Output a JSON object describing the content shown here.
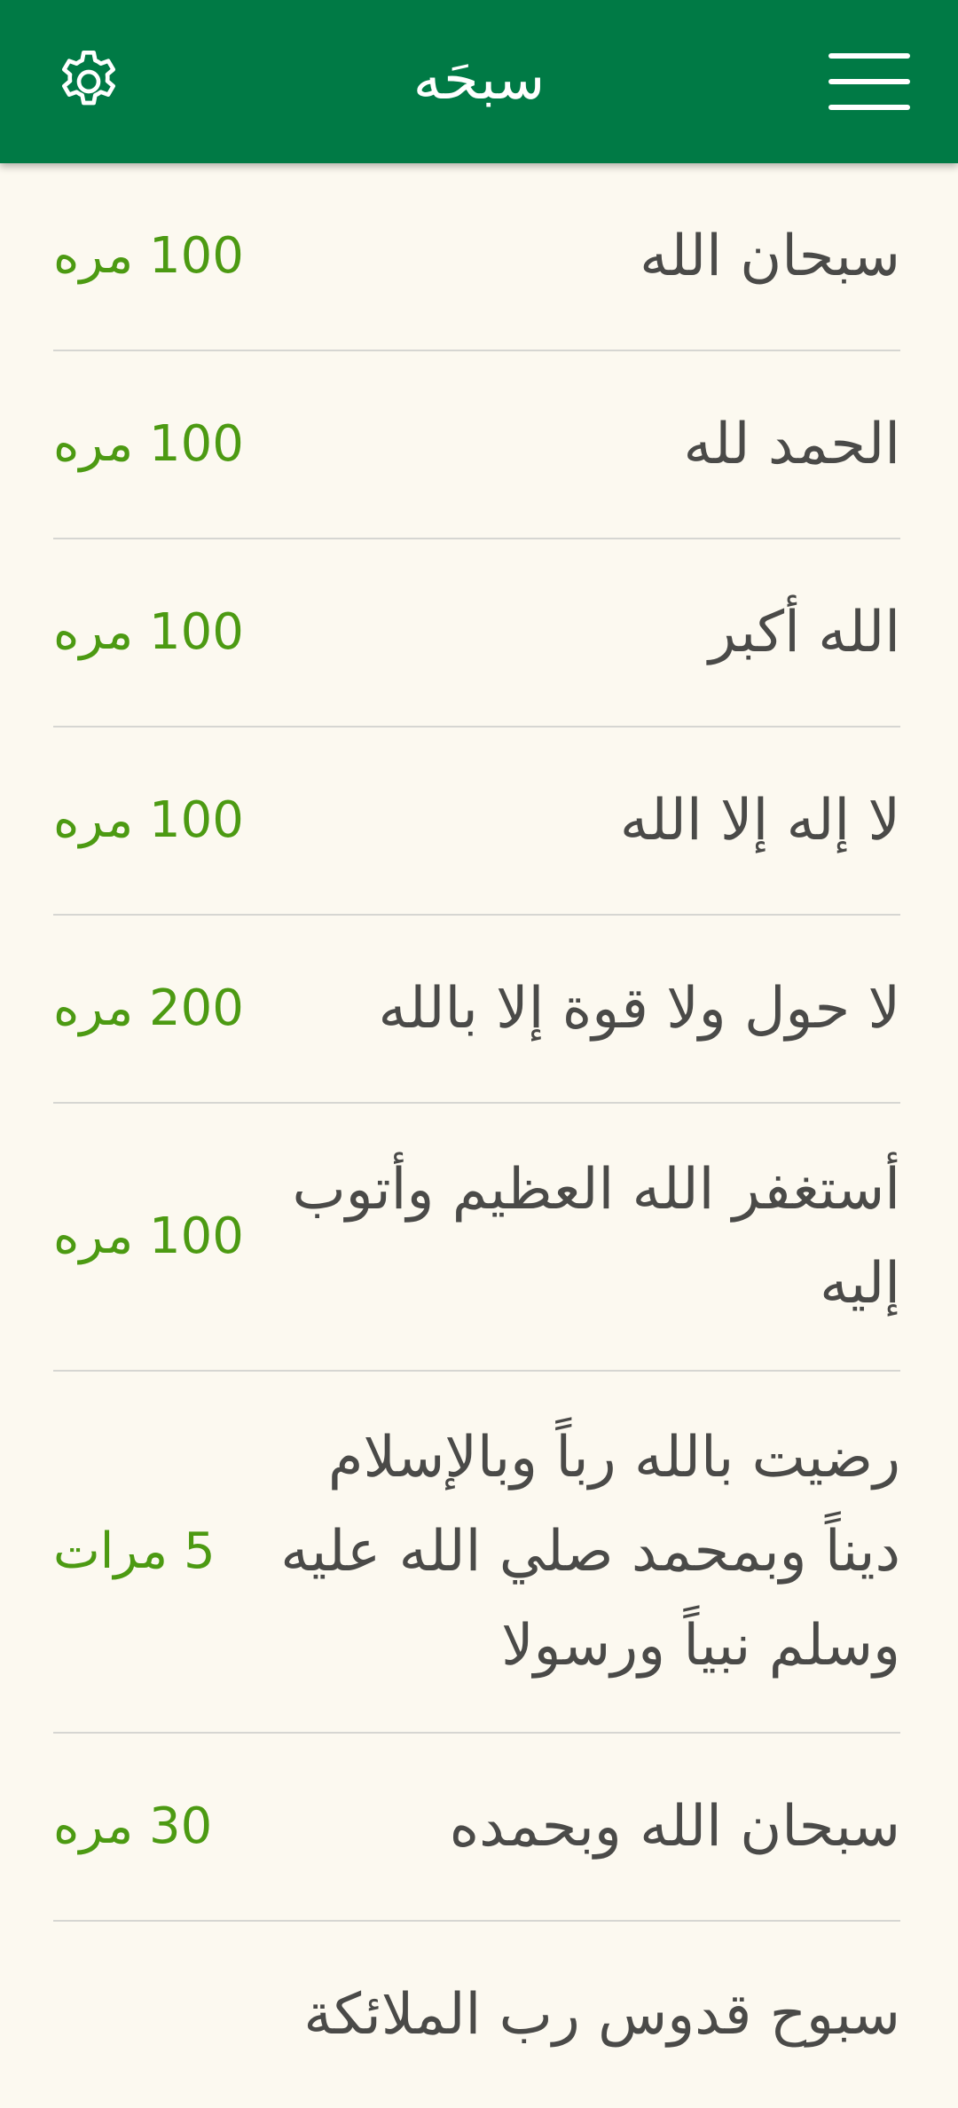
{
  "header": {
    "title": "سبحَه",
    "settings_icon": "gear-icon",
    "menu_icon": "hamburger-menu-icon",
    "background": "#007a45"
  },
  "colors": {
    "accent_green": "#4c9a12",
    "text_dark": "#4a4a48",
    "page_background": "#fcf9f0"
  },
  "items": [
    {
      "text": "سبحان الله",
      "count": "100 مره"
    },
    {
      "text": "الحمد لله",
      "count": "100 مره"
    },
    {
      "text": "الله أكبر",
      "count": "100 مره"
    },
    {
      "text": "لا إله إلا الله",
      "count": "100 مره"
    },
    {
      "text": "لا حول ولا قوة إلا بالله",
      "count": "200 مره"
    },
    {
      "text": "أستغفر الله العظيم وأتوب إليه",
      "count": "100 مره"
    },
    {
      "text": "رضيت بالله رباً وبالإسلام ديناً وبمحمد صلي الله عليه وسلم نبياً ورسولا",
      "count": "5 مرات"
    },
    {
      "text": "سبحان الله وبحمده",
      "count": "30 مره"
    },
    {
      "text": "سبوح قدوس رب الملائكة",
      "count": ""
    }
  ]
}
